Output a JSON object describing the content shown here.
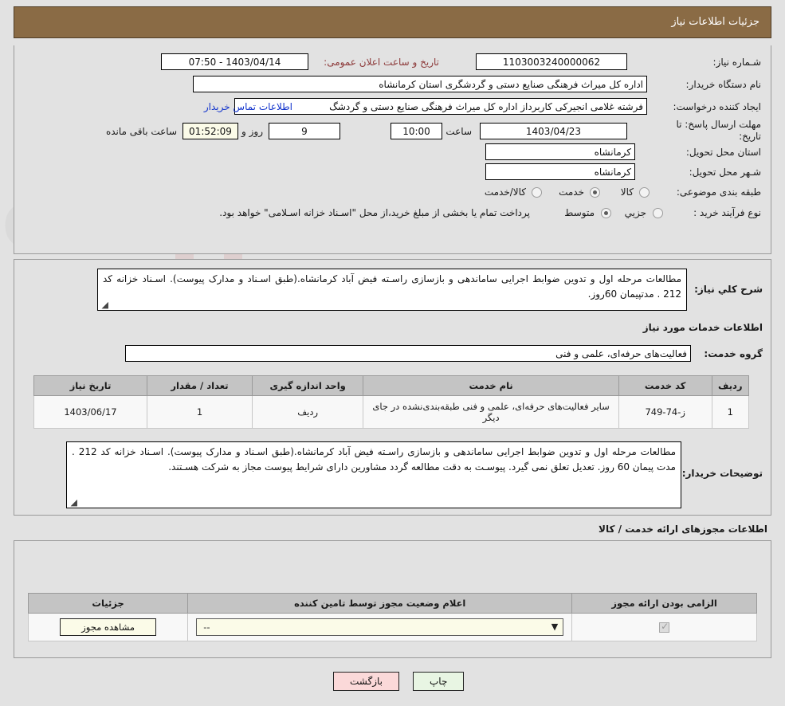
{
  "header": {
    "title": "جزئیات اطلاعات نیاز"
  },
  "form": {
    "need_number_label": "شـماره نیاز:",
    "need_number_value": "1103003240000062",
    "announce_label": "تاریخ و ساعت اعلان عمومی:",
    "announce_value": "1403/04/14 - 07:50",
    "buyer_org_label": "نام دستگاه خریدار:",
    "buyer_org_value": "اداره کل میراث فرهنگی  صنایع دستی و گردشگری استان کرمانشاه",
    "creator_label": "ایجاد کننده درخواست:",
    "creator_value": "فرشته غلامی انجیرکی کاربرداز اداره کل میراث فرهنگی  صنایع دستی و گردشگ",
    "contact_link": "اطلاعات تماس خریدار",
    "deadline_label": "مهلت ارسال پاسخ: تا تاریخ:",
    "deadline_date": "1403/04/23",
    "hour_label": "ساعت",
    "deadline_time": "10:00",
    "days_value": "9",
    "days_label": "روز و",
    "remaining_value": "01:52:09",
    "remaining_label": "ساعت باقی مانده",
    "province_label": "استان محل تحویل:",
    "province_value": "کرمانشاه",
    "city_label": "شـهر محل تحویل:",
    "city_value": "کرمانشاه",
    "category_label": "طبقه بندی موضوعی:",
    "category_options": [
      "کالا",
      "خدمت",
      "کالا/خدمت"
    ],
    "category_selected": "خدمت",
    "process_label": "نوع فرآیند خرید :",
    "process_options": [
      "جزیي",
      "متوسط"
    ],
    "process_selected": "متوسط",
    "payment_note": "پرداخت تمام یا بخشی از مبلغ خرید،از محل \"اسـناد خزانه اسـلامی\" خواهد بود."
  },
  "summary": {
    "label": "شرح کلي نیاز:",
    "text": "مطالعات مرحله اول و تدوین ضوابط اجرایی ساماندهی و بازسازی راسـته فیض آباد کرمانشاه.(طبق اسـناد و مدارک پیوست). اسـناد خزانه کد 212 . مدتپیمان 60روز."
  },
  "services": {
    "section_title": "اطلاعات خدمات مورد نیاز",
    "group_label": "گروه خدمت:",
    "group_value": "فعالیت‌های حرفه‌ای، علمی و فنی",
    "columns": [
      "ردیف",
      "کد خدمت",
      "نام خدمت",
      "واحد اندازه گیری",
      "تعداد / مقدار",
      "تاریخ نیاز"
    ],
    "rows": [
      {
        "row": "1",
        "code": "ز-74-749",
        "name": "سایر فعالیت‌های حرفه‌ای، علمی و فنی طبقه‌بندی‌نشده در جای دیگر",
        "unit": "ردیف",
        "qty": "1",
        "date": "1403/06/17"
      }
    ]
  },
  "buyer_notes": {
    "label": "توضیحات خریدار:",
    "text": "مطالعات مرحله اول و تدوین ضوابط اجرایی ساماندهی و بازسازی راسـته فیض آباد کرمانشاه.(طبق اسـناد و مدارک پیوست). اسـناد خزانه کد 212 . مدت پیمان 60 روز. تعدیل تعلق نمی گیرد. پیوسـت به دقت مطالعه گردد مشاورین دارای شرایط پیوست مجاز به شرکت هسـتند."
  },
  "permits": {
    "section_title": "اطلاعات مجوزهای ارائه خدمت / کالا",
    "columns": [
      "الزامی بودن ارائه مجوز",
      "اعلام وضعیت مجوز توسط تامین کننده",
      "جزئیات"
    ],
    "rows": [
      {
        "required_checked": true,
        "status_value": "--",
        "details_button": "مشاهده مجوز"
      }
    ]
  },
  "footer": {
    "print_label": "چاپ",
    "back_label": "بازگشت"
  }
}
